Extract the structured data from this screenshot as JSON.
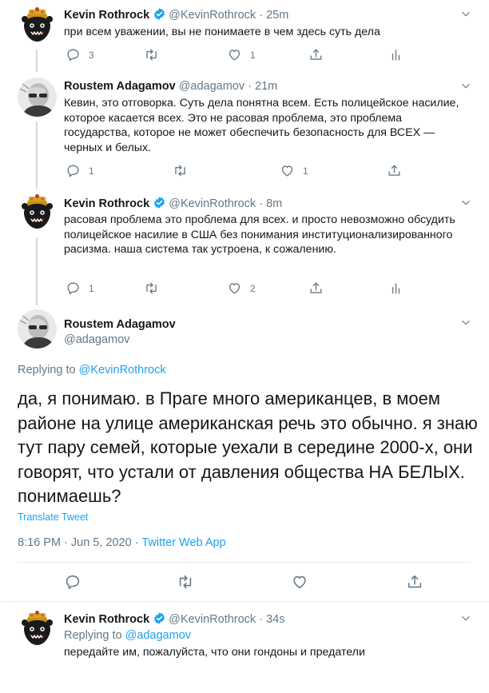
{
  "tweets": [
    {
      "name": "Kevin Rothrock",
      "handle": "@KevinRothrock",
      "dot": "·",
      "time": "25m",
      "text": "при всем уважении, вы не понимаете в чем здесь суть дела",
      "reply_count": "3",
      "retweet_count": "",
      "like_count": "1"
    },
    {
      "name": "Roustem Adagamov",
      "handle": "@adagamov",
      "dot": "·",
      "time": "21m",
      "text": "Кевин, это отговорка. Суть дела понятна всем. Есть полицейское насилие, которое касается всех. Это не расовая проблема, это проблема государства, которое не может обеспечить безопасность для ВСЕХ — черных и белых.",
      "reply_count": "1",
      "retweet_count": "",
      "like_count": "1"
    },
    {
      "name": "Kevin Rothrock",
      "handle": "@KevinRothrock",
      "dot": "·",
      "time": "8m",
      "text": "расовая проблема это проблема для всех. и просто невозможно обсудить полицейское насилие в США без понимания институционализированного расизма. наша система так устроена, к сожалению.",
      "reply_count": "1",
      "retweet_count": "",
      "like_count": "2"
    }
  ],
  "main_tweet": {
    "name": "Roustem Adagamov",
    "handle": "@adagamov",
    "replying_label": "Replying to",
    "replying_handle": "@KevinRothrock",
    "text": "да, я понимаю. в Праге много американцев, в моем районе на улице американская речь это обычно. я знаю тут пару семей, которые уехали в середине 2000-х, они говорят, что устали от давления общества НА БЕЛЫХ. понимаешь?",
    "translate": "Translate Tweet",
    "datetime": "8:16 PM · Jun 5, 2020 ·",
    "client": "Twitter Web App"
  },
  "last_tweet": {
    "name": "Kevin Rothrock",
    "handle": "@KevinRothrock",
    "dot": "·",
    "time": "34s",
    "replying_label": "Replying to",
    "replying_handle": "@adagamov",
    "text": "передайте им, пожалуйста, что они гондоны и предатели"
  },
  "colors": {
    "accent": "#1da1f2",
    "secondary_text": "#657786",
    "divider": "#e6ecf0"
  },
  "icons": [
    "reply-icon",
    "retweet-icon",
    "like-icon",
    "share-icon",
    "analytics-icon",
    "caret-down-icon",
    "verified-badge-icon"
  ]
}
